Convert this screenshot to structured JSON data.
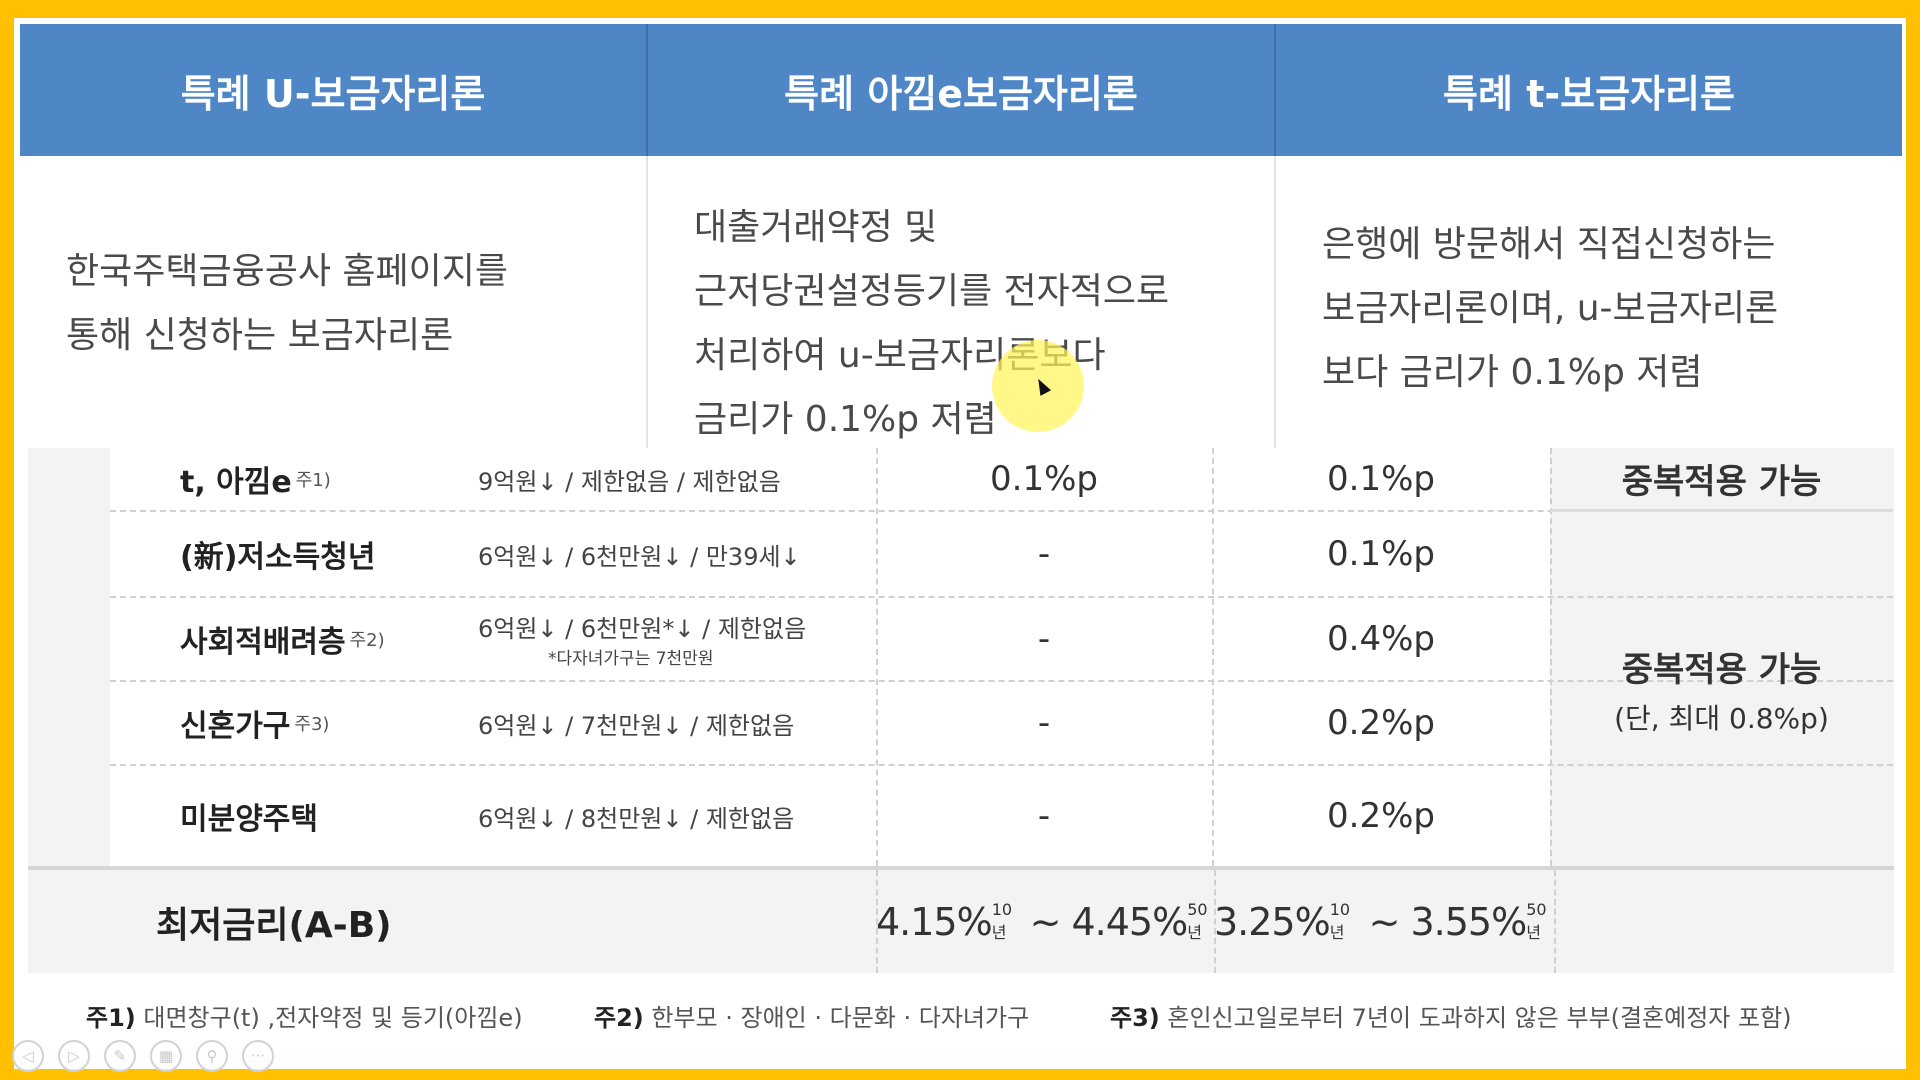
{
  "header": {
    "col1": "특례 U-보금자리론",
    "col2": "특례 아낌e보금자리론",
    "col3": "특례 t-보금자리론"
  },
  "descriptions": {
    "col1": "한국주택금융공사 홈페이지를\n통해 신청하는 보금자리론",
    "col2": "대출거래약정 및\n근저당권설정등기를 전자적으로\n처리하여 u-보금자리론보다\n금리가 0.1%p 저렴",
    "col3": "은행에 방문해서 직접신청하는\n보금자리론이며, u-보금자리론\n보다 금리가 0.1%p 저렴"
  },
  "table": {
    "rows": [
      {
        "name": "t, 아낌e",
        "note": "주1)",
        "cond": "9억원↓ / 제한없음 / 제한없음",
        "sub": "",
        "a": "0.1%p",
        "b": "0.1%p"
      },
      {
        "name": "(新)저소득청년",
        "note": "",
        "cond": "6억원↓ / 6천만원↓ / 만39세↓",
        "sub": "",
        "a": "-",
        "b": "0.1%p"
      },
      {
        "name": "사회적배려층",
        "note": "주2)",
        "cond": "6억원↓ / 6천만원*↓ / 제한없음",
        "sub": "*다자녀가구는 7천만원",
        "a": "-",
        "b": "0.4%p"
      },
      {
        "name": "신혼가구",
        "note": "주3)",
        "cond": "6억원↓ / 7천만원↓ / 제한없음",
        "sub": "",
        "a": "-",
        "b": "0.2%p"
      },
      {
        "name": "미분양주택",
        "note": "",
        "cond": "6억원↓ / 8천만원↓ / 제한없음",
        "sub": "",
        "a": "-",
        "b": "0.2%p"
      }
    ],
    "dup_top": "중복적용 가능",
    "dup_main": "중복적용 가능",
    "dup_sub": "(단, 최대 0.8%p)",
    "min_label": "최저금리(A-B)",
    "min_a_low": "4.15%",
    "min_a_low_term": "10년",
    "min_a_sep": " ~ ",
    "min_a_high": "4.45%",
    "min_a_high_term": "50년",
    "min_b_low": "3.25%",
    "min_b_low_term": "10년",
    "min_b_sep": " ~ ",
    "min_b_high": "3.55%",
    "min_b_high_term": "50년"
  },
  "footnotes": {
    "n1_key": "주1)",
    "n1_text": " 대면창구(t) ,전자약정 및 등기(아낌e)",
    "n2_key": "주2)",
    "n2_text": " 한부모 · 장애인 · 다문화 · 다자녀가구",
    "n3_key": "주3)",
    "n3_text": " 혼인신고일로부터 7년이 도과하지 않은 부부(결혼예정자 포함)"
  },
  "toolbar": {
    "icons": [
      "prev-icon",
      "next-icon",
      "pen-icon",
      "slides-icon",
      "zoom-icon",
      "more-icon"
    ],
    "glyphs": [
      "◁",
      "▷",
      "✎",
      "▦",
      "⚲",
      "···"
    ]
  },
  "colors": {
    "border": "#ffc000",
    "header_bg": "#4f86c6",
    "highlight": "#fff55a"
  }
}
